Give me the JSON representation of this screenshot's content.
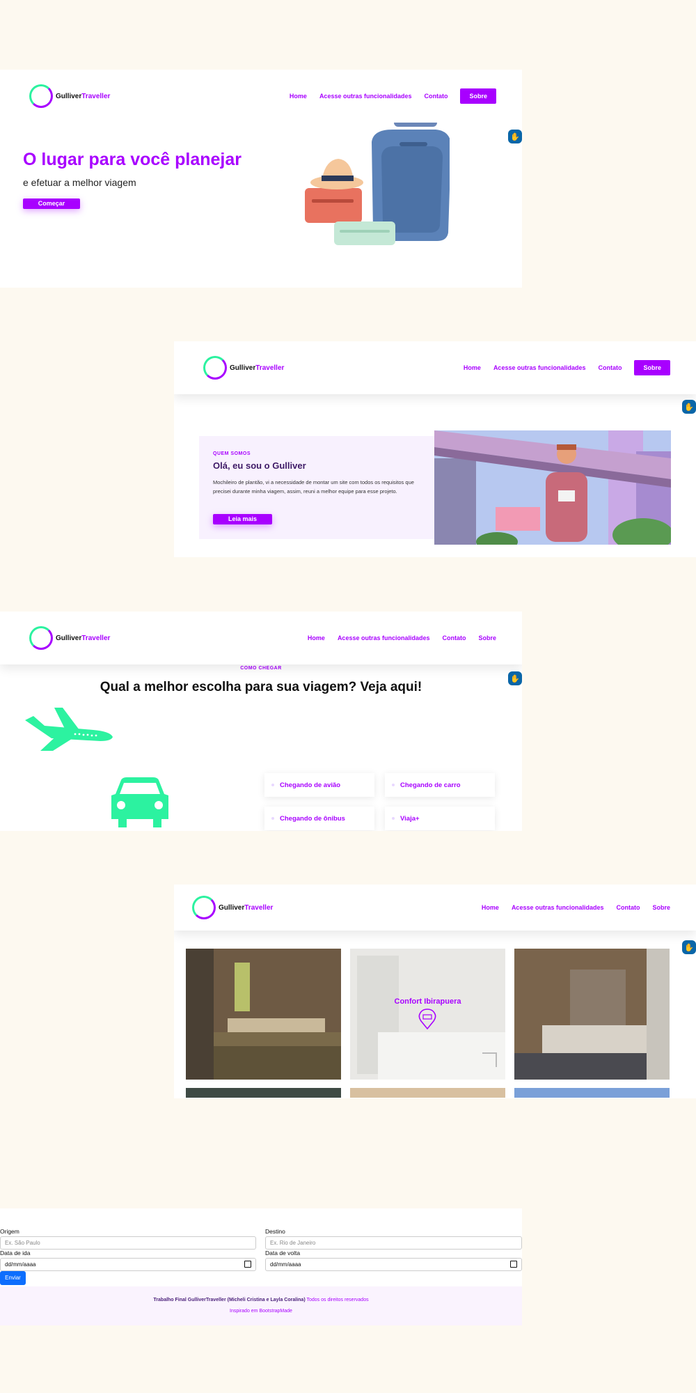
{
  "brand": {
    "part1": "Gulliver",
    "part2": "Traveller"
  },
  "nav": {
    "home": "Home",
    "features": "Acesse outras funcionalidades",
    "contact": "Contato",
    "about": "Sobre"
  },
  "hero": {
    "title": "O lugar para você planejar",
    "subtitle": "e efetuar a melhor viagem",
    "cta": "Começar"
  },
  "about": {
    "eyebrow": "QUEM SOMOS",
    "title": "Olá, eu sou o Gulliver",
    "text": "Mochileiro de plantão, vi a necessidade de montar um site com todos os requisitos que precisei durante minha viagem, assim, reuni a melhor equipe para esse projeto.",
    "cta": "Leia mais"
  },
  "how": {
    "eyebrow": "COMO CHEGAR",
    "title": "Qual a melhor escolha para sua viagem? Veja aqui!",
    "cards": [
      "Chegando de avião",
      "Chegando de carro",
      "Chegando de ônibus",
      "Viaja+"
    ]
  },
  "hotels": {
    "featured": "Confort Ibirapuera"
  },
  "form": {
    "origin_label": "Origem",
    "origin_placeholder": "Ex. São Paulo",
    "dest_label": "Destino",
    "dest_placeholder": "Ex. Rio de Janeiro",
    "depart_label": "Data de ida",
    "depart_value": "dd/mm/aaaa",
    "return_label": "Data de volta",
    "return_value": "dd/mm/aaaa",
    "submit": "Enviar"
  },
  "footer": {
    "credits": "Trabalho Final GulliverTraveller (Micheli Cristina e Layla Coralina)",
    "rights": "Todos os direitos reservados",
    "inspired_prefix": "Inspirado em",
    "inspired_link": "BootstrapMade"
  },
  "colors": {
    "accent": "#a800ff",
    "mint": "#2cf2a0",
    "page_bg": "#fdf9f0",
    "access_badge": "#0a66a8"
  },
  "icons": [
    "accessibility-icon",
    "airplane-icon",
    "car-icon",
    "map-pin-icon",
    "calendar-icon"
  ]
}
